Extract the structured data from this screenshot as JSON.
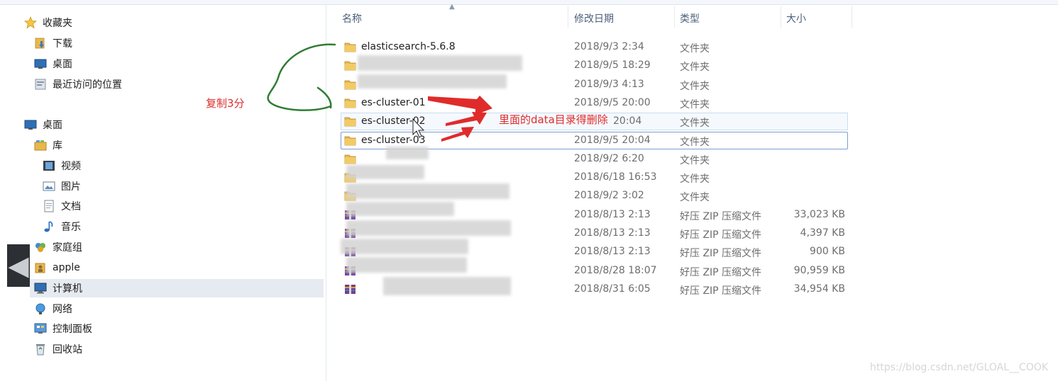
{
  "nav": {
    "favorites": [
      {
        "label": "收藏夹",
        "icon": "star-icon"
      },
      {
        "label": "下载",
        "icon": "download-folder-icon"
      },
      {
        "label": "桌面",
        "icon": "desktop-icon"
      },
      {
        "label": "最近访问的位置",
        "icon": "recent-places-icon"
      }
    ],
    "tree": [
      {
        "label": "桌面",
        "icon": "desktop-icon"
      },
      {
        "label": "库",
        "icon": "library-icon"
      },
      {
        "label": "视频",
        "icon": "video-icon"
      },
      {
        "label": "图片",
        "icon": "picture-icon"
      },
      {
        "label": "文档",
        "icon": "document-icon"
      },
      {
        "label": "音乐",
        "icon": "music-icon"
      },
      {
        "label": "家庭组",
        "icon": "homegroup-icon"
      },
      {
        "label": "apple",
        "icon": "user-folder-icon"
      },
      {
        "label": "计算机",
        "icon": "computer-icon"
      },
      {
        "label": "网络",
        "icon": "network-icon"
      },
      {
        "label": "控制面板",
        "icon": "control-panel-icon"
      },
      {
        "label": "回收站",
        "icon": "recycle-bin-icon"
      }
    ],
    "collapse_glyph": "◀"
  },
  "columns": {
    "name": "名称",
    "modified": "修改日期",
    "type": "类型",
    "size": "大小"
  },
  "files": [
    {
      "name": "elasticsearch-5.6.8",
      "modified": "2018/9/3 2:34",
      "type": "文件夹",
      "size": "",
      "icon": "folder-icon"
    },
    {
      "name": "",
      "modified": "2018/9/5 18:29",
      "type": "文件夹",
      "size": "",
      "icon": "folder-icon"
    },
    {
      "name": "",
      "modified": "2018/9/3 4:13",
      "type": "文件夹",
      "size": "",
      "icon": "folder-icon"
    },
    {
      "name": "es-cluster-01",
      "modified": "2018/9/5 20:00",
      "type": "文件夹",
      "size": "",
      "icon": "folder-icon"
    },
    {
      "name": "es-cluster-02",
      "modified": "20:04",
      "type": "文件夹",
      "size": "",
      "icon": "folder-icon"
    },
    {
      "name": "es-cluster-03",
      "modified": "2018/9/5 20:04",
      "type": "文件夹",
      "size": "",
      "icon": "folder-icon"
    },
    {
      "name": "",
      "modified": "2018/9/2 6:20",
      "type": "文件夹",
      "size": "",
      "icon": "folder-icon"
    },
    {
      "name": "",
      "modified": "2018/6/18 16:53",
      "type": "文件夹",
      "size": "",
      "icon": "folder-icon"
    },
    {
      "name": "",
      "modified": "2018/9/2 3:02",
      "type": "文件夹",
      "size": "",
      "icon": "folder-icon"
    },
    {
      "name": "",
      "modified": "2018/8/13 2:13",
      "type": "好压 ZIP 压缩文件",
      "size": "33,023 KB",
      "icon": "zip-archive-icon"
    },
    {
      "name": "",
      "modified": "2018/8/13 2:13",
      "type": "好压 ZIP 压缩文件",
      "size": "4,397 KB",
      "icon": "zip-archive-icon"
    },
    {
      "name": "",
      "modified": "2018/8/13 2:13",
      "type": "好压 ZIP 压缩文件",
      "size": "900 KB",
      "icon": "zip-archive-icon"
    },
    {
      "name": "",
      "modified": "2018/8/28 18:07",
      "type": "好压 ZIP 压缩文件",
      "size": "90,959 KB",
      "icon": "zip-archive-icon"
    },
    {
      "name": "",
      "modified": "2018/8/31 6:05",
      "type": "好压 ZIP 压缩文件",
      "size": "34,954 KB",
      "icon": "zip-archive-icon"
    }
  ],
  "annotations": {
    "copy_note": "复制3分",
    "delete_note": "里面的data目录得删除"
  },
  "watermark": "https://blog.csdn.net/GLOAL__COOK",
  "colors": {
    "annotation_red": "#e02b2b",
    "annotation_green": "#2f7d32",
    "folder_yellow": "#e8b84a",
    "selection_border": "#7d9dd0"
  }
}
